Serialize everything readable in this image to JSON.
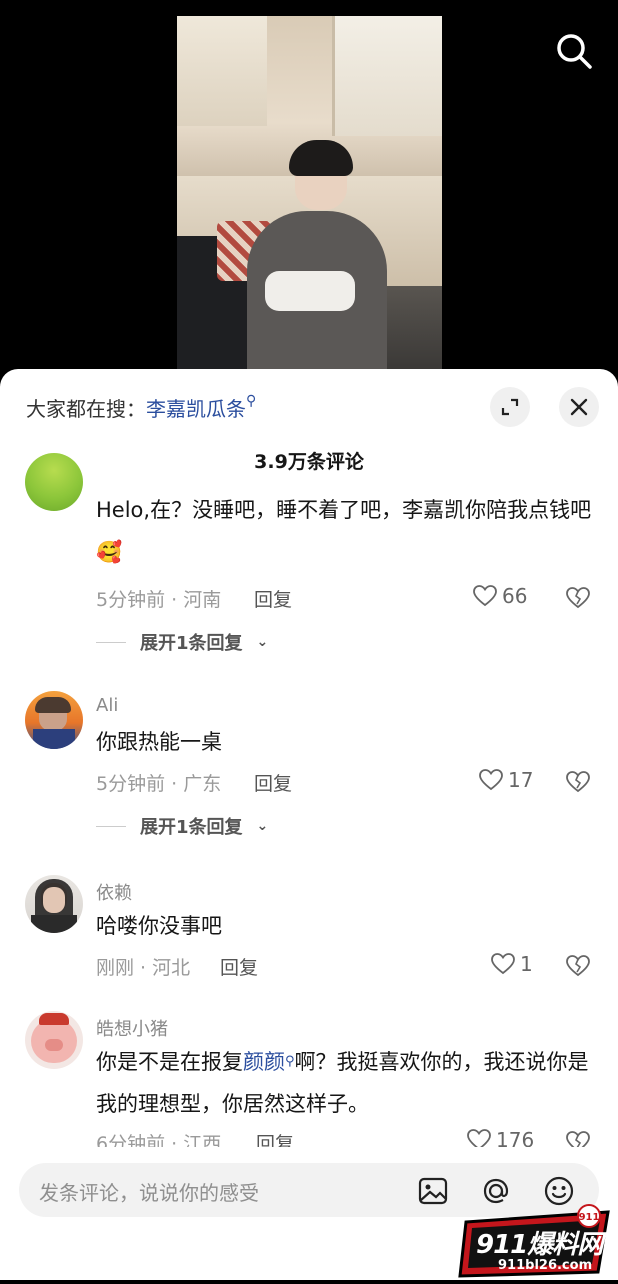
{
  "video": {},
  "panel": {
    "hot_search_prefix": "大家都在搜：",
    "hot_search_keyword": "李嘉凯瓜条",
    "comment_count_title": "3.9万条评论"
  },
  "comments": [
    {
      "username": "",
      "text": "Helo,在？没睡吧，睡不着了吧，李嘉凯你陪我点钱吧",
      "emoji": "🥰",
      "meta": "5分钟前 · 河南",
      "reply_label": "回复",
      "likes": "66",
      "expand_label": "展开1条回复"
    },
    {
      "username": "Ali",
      "text": "你跟热能一桌",
      "meta": "5分钟前 · 广东",
      "reply_label": "回复",
      "likes": "17",
      "expand_label": "展开1条回复"
    },
    {
      "username": "依赖",
      "text": "哈喽你没事吧",
      "meta": "刚刚 · 河北",
      "reply_label": "回复",
      "likes": "1"
    },
    {
      "username": "皓想小猪",
      "text_before": "你是不是在报复",
      "mention": "颜颜",
      "text_after": "啊？我挺喜欢你的，我还说你是我的理想型，你居然这样子。",
      "meta": "6分钟前 · 江西",
      "reply_label": "回复",
      "likes": "176"
    }
  ],
  "input": {
    "placeholder": "发条评论，说说你的感受"
  },
  "watermark": {
    "brand": "911爆料网",
    "url": "911bl26.com"
  },
  "icons": {
    "search": "search-icon",
    "expand": "expand-icon",
    "close": "close-icon",
    "heart": "heart-icon",
    "dislike": "broken-heart-icon",
    "image": "image-icon",
    "mention": "at-icon",
    "emoji": "emoji-icon",
    "chevron": "chevron-down-icon"
  }
}
